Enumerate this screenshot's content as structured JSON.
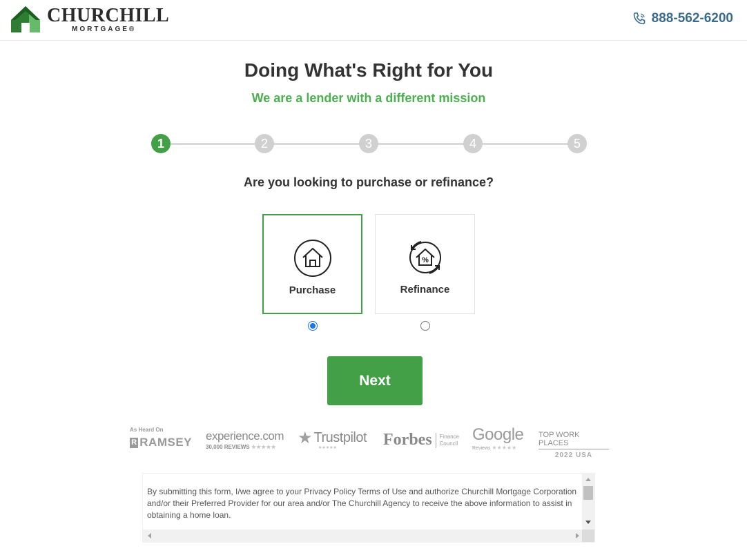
{
  "header": {
    "logo_word": "CHURCHILL",
    "logo_sub": "MORTGAGE®",
    "phone": "888-562-6200"
  },
  "hero": {
    "title": "Doing What's Right for You",
    "subtitle": "We are a lender with a different mission"
  },
  "stepper": {
    "steps": [
      "1",
      "2",
      "3",
      "4",
      "5"
    ],
    "current": 1
  },
  "question": "Are you looking to purchase or refinance?",
  "options": [
    {
      "label": "Purchase",
      "icon": "house-icon",
      "selected": true
    },
    {
      "label": "Refinance",
      "icon": "refinance-house-percent-icon",
      "selected": false
    }
  ],
  "next_label": "Next",
  "trust": {
    "ramsey_top": "As Heard On",
    "ramsey_r": "R",
    "ramsey_word": "RAMSEY",
    "experience_word": "experience.com",
    "experience_sub": "30,000 REVIEWS",
    "trustpilot_word": "Trustpilot",
    "forbes_word": "Forbes",
    "forbes_sub1": "Finance",
    "forbes_sub2": "Council",
    "google_word": "Google",
    "google_sub": "Reviews",
    "twp_top": "TOP WORK PLACES",
    "twp_sub": "2022 USA"
  },
  "consent_text": "By submitting this form, I/we agree to your Privacy Policy Terms of Use and authorize Churchill Mortgage Corporation and/or their Preferred Provider for our area and/or The Churchill Agency to receive the above information to assist in obtaining a home loan.",
  "colors": {
    "brand_green": "#43a047",
    "subtitle_green": "#4caf50",
    "phone_blue": "#3a6b8c",
    "radio_blue": "#1a73e8"
  }
}
